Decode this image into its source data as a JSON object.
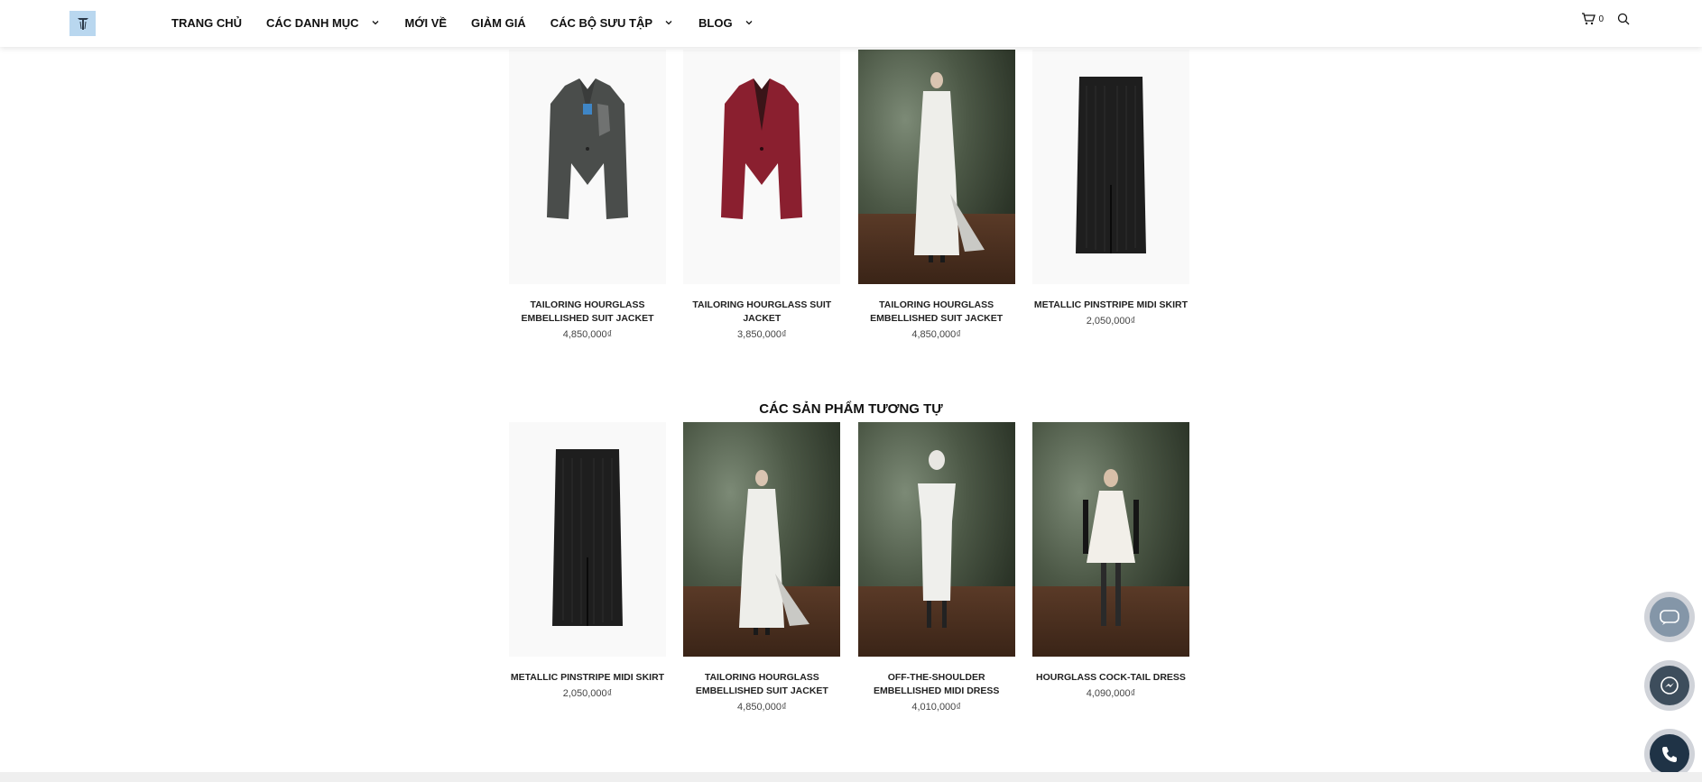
{
  "header": {
    "logo_alt": "logo",
    "nav": [
      {
        "label": "TRANG CHỦ",
        "has_dropdown": false
      },
      {
        "label": "CÁC DANH MỤC",
        "has_dropdown": true
      },
      {
        "label": "MỚI VỀ",
        "has_dropdown": false
      },
      {
        "label": "GIẢM GIÁ",
        "has_dropdown": false
      },
      {
        "label": "CÁC BỘ SƯU TẬP",
        "has_dropdown": true
      },
      {
        "label": "BLOG",
        "has_dropdown": true
      }
    ],
    "cart_count": "0",
    "icons": {
      "cart": "cart-icon",
      "search": "search-icon"
    }
  },
  "top_products": [
    {
      "name": "TAILORING HOURGLASS EMBELLISHED SUIT JACKET",
      "price": "4,850,000₫"
    },
    {
      "name": "TAILORING HOURGLASS SUIT JACKET",
      "price": "3,850,000₫"
    },
    {
      "name": "TAILORING HOURGLASS EMBELLISHED SUIT JACKET",
      "price": "4,850,000₫"
    },
    {
      "name": "METALLIC PINSTRIPE MIDI SKIRT",
      "price": "2,050,000₫"
    }
  ],
  "similar": {
    "title": "CÁC SẢN PHẨM TƯƠNG TỰ",
    "products": [
      {
        "name": "METALLIC PINSTRIPE MIDI SKIRT",
        "price": "2,050,000₫"
      },
      {
        "name": "TAILORING HOURGLASS EMBELLISHED SUIT JACKET",
        "price": "4,850,000₫"
      },
      {
        "name": "OFF-THE-SHOULDER EMBELLISHED MIDI DRESS",
        "price": "4,010,000₫"
      },
      {
        "name": "HOURGLASS COCK-TAIL DRESS",
        "price": "4,090,000₫"
      }
    ]
  },
  "floating_buttons": [
    {
      "name": "zalo-chat-button",
      "icon": "zalo-icon"
    },
    {
      "name": "messenger-button",
      "icon": "messenger-icon"
    },
    {
      "name": "phone-call-button",
      "icon": "phone-icon"
    }
  ],
  "colors": {
    "logo_bg": "#b9d7ef",
    "text": "#111111",
    "price": "#444444",
    "footer": "#efefef"
  }
}
